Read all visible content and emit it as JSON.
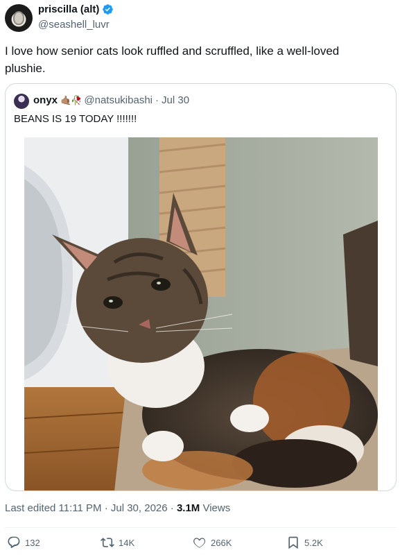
{
  "author": {
    "display_name": "priscilla (alt)",
    "handle": "@seashell_luvr",
    "avatar_icon": "seashell-avatar",
    "verified": true
  },
  "tweet": {
    "text": "I love how senior cats look ruffled and scruffled, like a well-loved plushie."
  },
  "quoted_tweet": {
    "display_name": "onyx",
    "emoji": "🤙🏽🥀",
    "handle": "@natsukibashi",
    "separator": "·",
    "date": "Jul 30",
    "text": "BEANS IS 19 TODAY !!!!!!!",
    "media": {
      "type": "photo"
    }
  },
  "meta": {
    "edited": "Last edited 11:11 PM · Jul 30, 2026 · ",
    "views_count": "3.1M",
    "views_label": " Views"
  },
  "actions": {
    "replies": "132",
    "reposts": "14K",
    "likes": "266K",
    "bookmarks": "5.2K"
  },
  "colors": {
    "verified_blue": "#1d9bf0",
    "text_primary": "#0f1419",
    "text_secondary": "#536471",
    "border": "#cfd9de"
  }
}
